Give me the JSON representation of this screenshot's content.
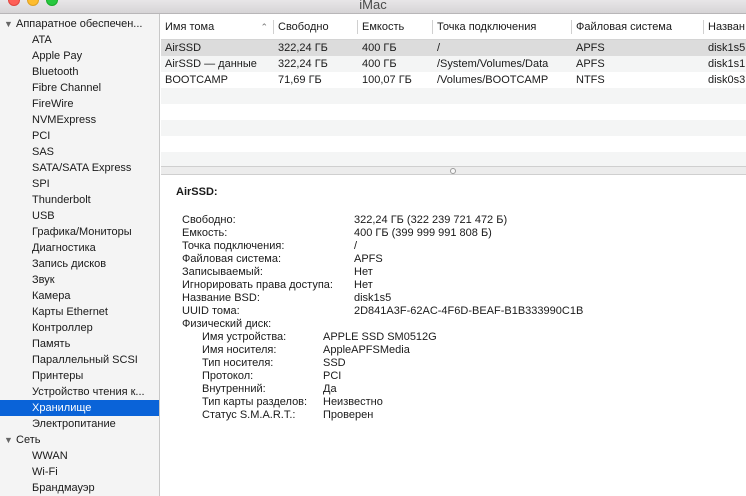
{
  "window": {
    "title": "iMac"
  },
  "sidebar": {
    "items": [
      {
        "label": "Аппаратное обеспечен...",
        "type": "category",
        "expanded": true
      },
      {
        "label": "ATA",
        "type": "child"
      },
      {
        "label": "Apple Pay",
        "type": "child"
      },
      {
        "label": "Bluetooth",
        "type": "child"
      },
      {
        "label": "Fibre Channel",
        "type": "child"
      },
      {
        "label": "FireWire",
        "type": "child"
      },
      {
        "label": "NVMExpress",
        "type": "child"
      },
      {
        "label": "PCI",
        "type": "child"
      },
      {
        "label": "SAS",
        "type": "child"
      },
      {
        "label": "SATA/SATA Express",
        "type": "child"
      },
      {
        "label": "SPI",
        "type": "child"
      },
      {
        "label": "Thunderbolt",
        "type": "child"
      },
      {
        "label": "USB",
        "type": "child"
      },
      {
        "label": "Графика/Мониторы",
        "type": "child"
      },
      {
        "label": "Диагностика",
        "type": "child"
      },
      {
        "label": "Запись дисков",
        "type": "child"
      },
      {
        "label": "Звук",
        "type": "child"
      },
      {
        "label": "Камера",
        "type": "child"
      },
      {
        "label": "Карты Ethernet",
        "type": "child"
      },
      {
        "label": "Контроллер",
        "type": "child"
      },
      {
        "label": "Память",
        "type": "child"
      },
      {
        "label": "Параллельный SCSI",
        "type": "child"
      },
      {
        "label": "Принтеры",
        "type": "child"
      },
      {
        "label": "Устройство чтения к...",
        "type": "child"
      },
      {
        "label": "Хранилище",
        "type": "child",
        "selected": true
      },
      {
        "label": "Электропитание",
        "type": "child"
      },
      {
        "label": "Сеть",
        "type": "category",
        "expanded": true
      },
      {
        "label": "WWAN",
        "type": "child"
      },
      {
        "label": "Wi-Fi",
        "type": "child"
      },
      {
        "label": "Брандмауэр",
        "type": "child"
      }
    ]
  },
  "table": {
    "columns": [
      "Имя тома",
      "Свободно",
      "Емкость",
      "Точка подключения",
      "Файловая система",
      "Назван"
    ],
    "rows": [
      [
        "AirSSD",
        "322,24 ГБ",
        "400 ГБ",
        "/",
        "APFS",
        "disk1s5"
      ],
      [
        "AirSSD — данные",
        "322,24 ГБ",
        "400 ГБ",
        "/System/Volumes/Data",
        "APFS",
        "disk1s1"
      ],
      [
        "BOOTCAMP",
        "71,69 ГБ",
        "100,07 ГБ",
        "/Volumes/BOOTCAMP",
        "NTFS",
        "disk0s3"
      ]
    ],
    "selected_row": 0
  },
  "detail": {
    "title": "AirSSD:",
    "fields": [
      {
        "key": "Свободно:",
        "value": "322,24 ГБ (322 239 721 472 Б)"
      },
      {
        "key": "Емкость:",
        "value": "400 ГБ (399 999 991 808 Б)"
      },
      {
        "key": "Точка подключения:",
        "value": "/"
      },
      {
        "key": "Файловая система:",
        "value": "APFS"
      },
      {
        "key": "Записываемый:",
        "value": "Нет"
      },
      {
        "key": "Игнорировать права доступа:",
        "value": "Нет"
      },
      {
        "key": "Название BSD:",
        "value": "disk1s5"
      },
      {
        "key": "UUID тома:",
        "value": "2D841A3F-62AC-4F6D-BEAF-B1B333990C1B"
      }
    ],
    "physical_disk_label": "Физический диск:",
    "physical_fields": [
      {
        "key": "Имя устройства:",
        "value": "APPLE SSD SM0512G"
      },
      {
        "key": "Имя носителя:",
        "value": "AppleAPFSMedia"
      },
      {
        "key": "Тип носителя:",
        "value": "SSD"
      },
      {
        "key": "Протокол:",
        "value": "PCI"
      },
      {
        "key": "Внутренний:",
        "value": "Да"
      },
      {
        "key": "Тип карты разделов:",
        "value": "Неизвестно"
      },
      {
        "key": "Статус S.M.A.R.T.:",
        "value": "Проверен"
      }
    ]
  }
}
